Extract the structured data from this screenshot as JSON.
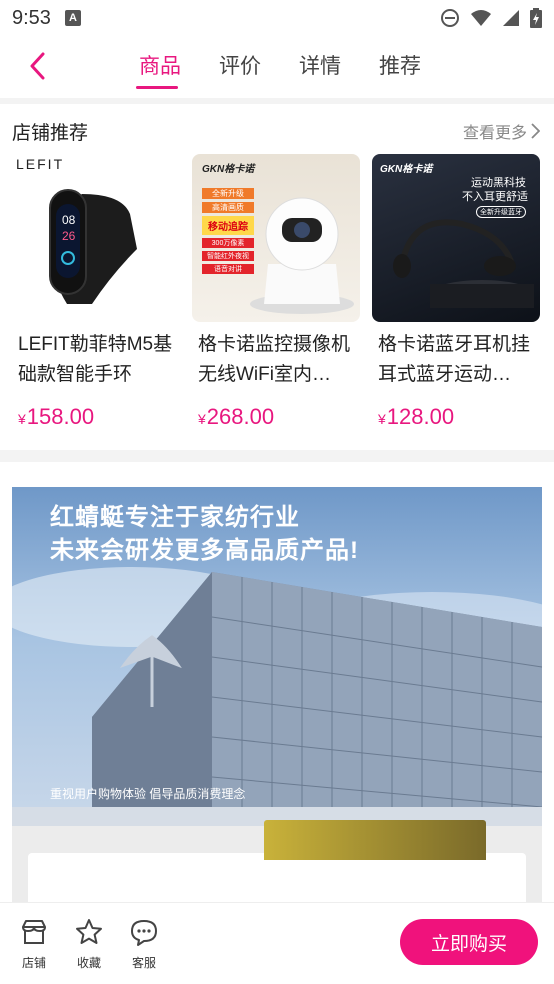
{
  "status_bar": {
    "time": "9:53"
  },
  "tabs": [
    {
      "label": "商品"
    },
    {
      "label": "评价"
    },
    {
      "label": "详情"
    },
    {
      "label": "推荐"
    }
  ],
  "shop_recommend": {
    "title": "店铺推荐",
    "see_more": "查看更多",
    "products": [
      {
        "brand": "LEFIT",
        "name": "LEFIT勒菲特M5基础款智能手环",
        "currency": "¥",
        "price": "158.00"
      },
      {
        "brand": "GKN格卡诺",
        "name": "格卡诺监控摄像机无线WiFi室内…",
        "currency": "¥",
        "price": "268.00",
        "image_tags": [
          "全新升级",
          "高清画质",
          "移动追踪",
          "300万像素",
          "智能红外夜视",
          "语音对讲"
        ]
      },
      {
        "brand": "GKN格卡诺",
        "name": "格卡诺蓝牙耳机挂耳式蓝牙运动…",
        "currency": "¥",
        "price": "128.00",
        "image_tags": [
          "运动黑科技",
          "不入耳更舒适",
          "全新升级蓝牙"
        ]
      }
    ]
  },
  "banner": {
    "line1": "红蜻蜓专注于家纺行业",
    "line2": "未来会研发更多高品质产品!",
    "caption": "重视用户购物体验 倡导品质消费理念"
  },
  "bottom_bar": {
    "shop": "店铺",
    "favorite": "收藏",
    "service": "客服",
    "buy": "立即购买"
  },
  "colors": {
    "accent": "#e8177f",
    "buy_button": "#f0127c"
  }
}
